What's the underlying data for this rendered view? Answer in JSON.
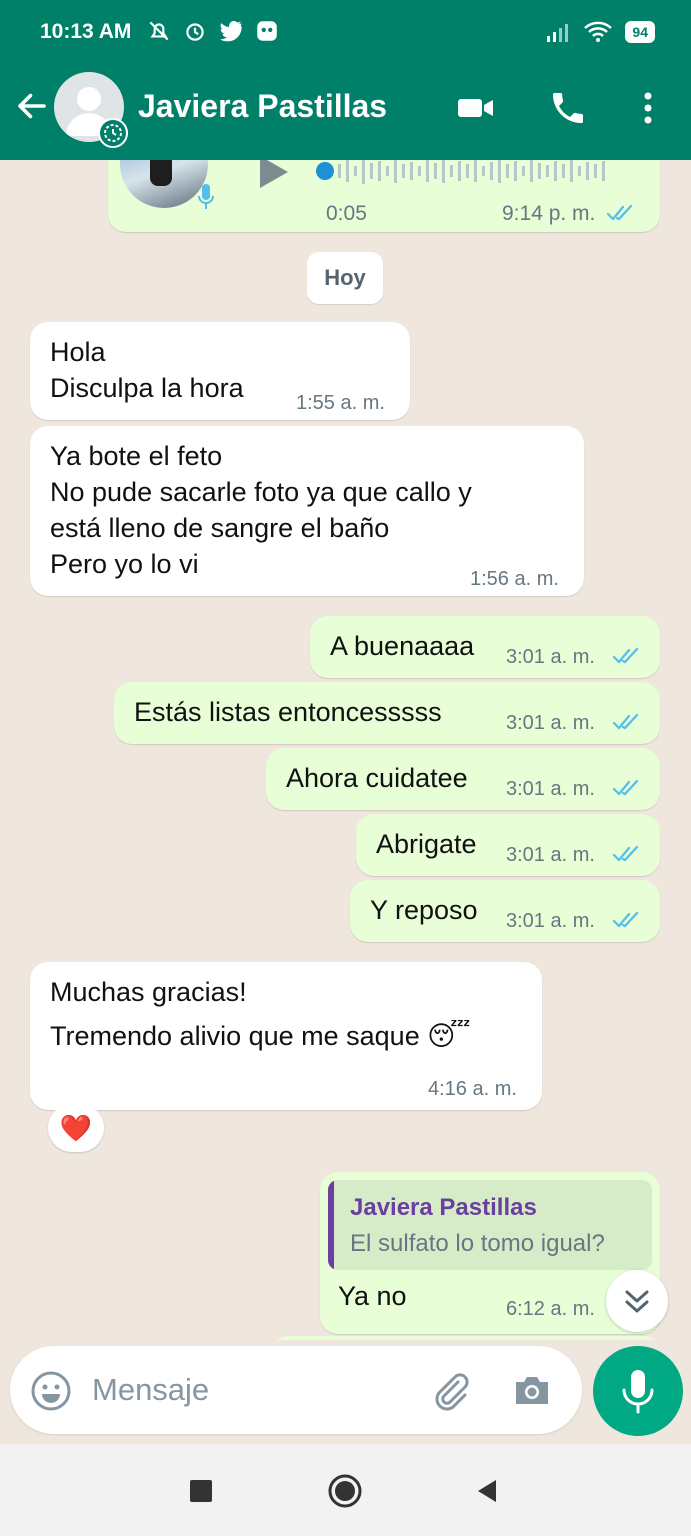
{
  "status_bar": {
    "time": "10:13 AM",
    "battery": "94"
  },
  "header": {
    "contact_name": "Javiera Pastillas"
  },
  "voice_message": {
    "duration": "0:05",
    "time": "9:14 p. m."
  },
  "date_divider": "Hoy",
  "messages": [
    {
      "direction": "in",
      "lines": [
        "Hola",
        "Disculpa la hora"
      ],
      "time": "1:55 a. m."
    },
    {
      "direction": "in",
      "lines": [
        "Ya bote el feto",
        "No pude sacarle foto ya que callo y",
        "está lleno de sangre el baño",
        "Pero yo lo vi"
      ],
      "time": "1:56 a. m."
    },
    {
      "direction": "out",
      "text": "A buenaaaa",
      "time": "3:01 a. m."
    },
    {
      "direction": "out",
      "text": "Estás listas entoncesssss",
      "time": "3:01 a. m."
    },
    {
      "direction": "out",
      "text": "Ahora cuidatee",
      "time": "3:01 a. m."
    },
    {
      "direction": "out",
      "text": "Abrigate",
      "time": "3:01 a. m."
    },
    {
      "direction": "out",
      "text": "Y reposo",
      "time": "3:01 a. m."
    },
    {
      "direction": "in",
      "lines": [
        "Muchas gracias!",
        "Tremendo alivio que me saque 😴"
      ],
      "time": "4:16 a. m.",
      "reaction": "❤️"
    },
    {
      "direction": "out",
      "quote_author": "Javiera Pastillas",
      "quote_text": "El sulfato lo tomo igual?",
      "text": "Ya no",
      "time": "6:12 a. m."
    }
  ],
  "composer": {
    "placeholder": "Mensaje"
  },
  "colors": {
    "header": "#008069",
    "outgoing_bubble": "#e7fed7",
    "incoming_bubble": "#ffffff",
    "chat_bg": "#efe7dd",
    "read_ticks": "#53bdeb",
    "quote_accent": "#6b3fa0",
    "mic_button": "#00a884"
  }
}
